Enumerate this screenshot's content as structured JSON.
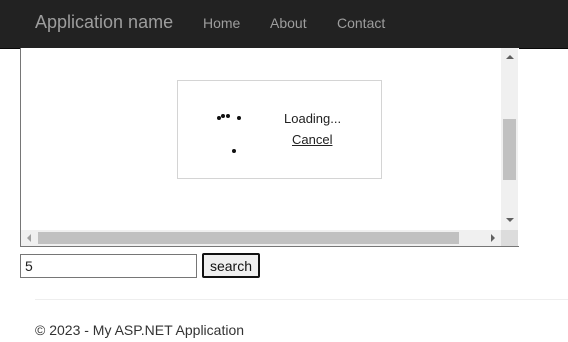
{
  "navbar": {
    "brand": "Application name",
    "links": [
      "Home",
      "About",
      "Contact"
    ]
  },
  "loading": {
    "text": "Loading...",
    "cancel": "Cancel"
  },
  "search": {
    "value": "5",
    "button": "search"
  },
  "footer": {
    "text": "© 2023 - My ASP.NET Application"
  },
  "colors": {
    "navbar_bg": "#222222",
    "nav_text": "#9d9d9d"
  }
}
